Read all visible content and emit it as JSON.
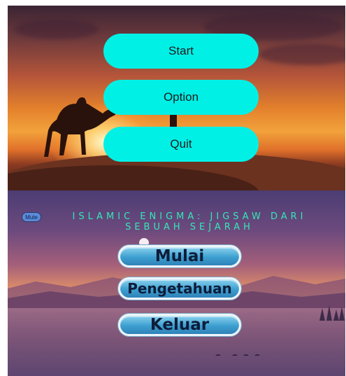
{
  "top_menu": {
    "start_label": "Start",
    "option_label": "Option",
    "quit_label": "Quit"
  },
  "bottom_menu": {
    "mute_label": "Mute",
    "title_line1": "ISLAMIC ENIGMA: JIGSAW DARI",
    "title_line2": "SEBUAH SEJARAH",
    "mulai_label": "Mulai",
    "pengetahuan_label": "Pengetahuan",
    "keluar_label": "Keluar"
  },
  "colors": {
    "top_button": "#00f0e6",
    "title_text": "#34e8b8",
    "bottom_button": "#3d9fd0"
  }
}
